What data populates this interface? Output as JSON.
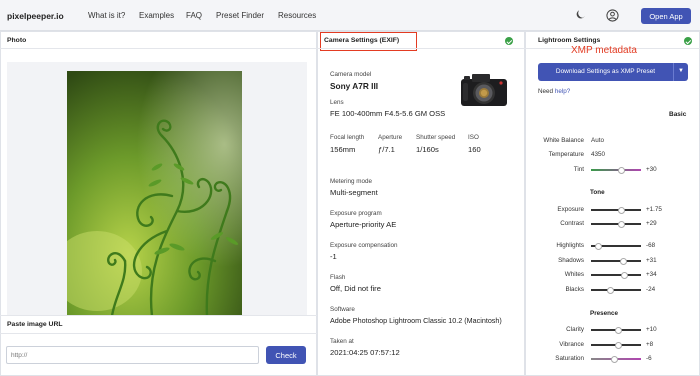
{
  "nav": {
    "logo": "pixelpeeper.io",
    "links": [
      "What is it?",
      "Examples",
      "FAQ",
      "Preset Finder",
      "Resources"
    ],
    "open_app": "Open App",
    "moon_icon": "moon-icon",
    "user_icon": "user-icon"
  },
  "photo_panel": {
    "title": "Photo",
    "paste_label": "Paste image URL",
    "url_placeholder": "http://",
    "check": "Check"
  },
  "exif": {
    "title": "Camera Settings (EXIF)",
    "camera_model_label": "Camera model",
    "camera_model": "Sony A7R III",
    "lens_label": "Lens",
    "lens": "FE 100-400mm F4.5-5.6 GM OSS",
    "focal_length_label": "Focal length",
    "focal_length": "156mm",
    "aperture_label": "Aperture",
    "aperture": "ƒ/7.1",
    "shutter_label": "Shutter speed",
    "shutter": "1/160s",
    "iso_label": "ISO",
    "iso": "160",
    "metering_label": "Metering mode",
    "metering": "Multi-segment",
    "program_label": "Exposure program",
    "program": "Aperture-priority AE",
    "comp_label": "Exposure compensation",
    "comp": "-1",
    "flash_label": "Flash",
    "flash": "Off, Did not fire",
    "software_label": "Software",
    "software": "Adobe Photoshop Lightroom Classic 10.2 (Macintosh)",
    "taken_label": "Taken at",
    "taken": "2021:04:25 07:57:12"
  },
  "lightroom": {
    "title": "Lightroom Settings",
    "annotation": "XMP metadata",
    "download": "Download Settings as XMP Preset",
    "need": "Need ",
    "help": "help?",
    "basic": "Basic",
    "wb_label": "White Balance",
    "wb": "Auto",
    "temp_label": "Temperature",
    "temp": "4350",
    "tint_label": "Tint",
    "tint": "+30",
    "tone": "Tone",
    "exposure_label": "Exposure",
    "exposure": "+1.75",
    "contrast_label": "Contrast",
    "contrast": "+29",
    "highlights_label": "Highlights",
    "highlights": "-68",
    "shadows_label": "Shadows",
    "shadows": "+31",
    "whites_label": "Whites",
    "whites": "+34",
    "blacks_label": "Blacks",
    "blacks": "-24",
    "presence": "Presence",
    "clarity_label": "Clarity",
    "clarity": "+10",
    "vibrance_label": "Vibrance",
    "vibrance": "+8",
    "saturation_label": "Saturation",
    "saturation": "-6"
  },
  "sliders": {
    "tint": 0.6,
    "exposure": 0.6,
    "contrast": 0.6,
    "highlights": 0.15,
    "shadows": 0.65,
    "whites": 0.67,
    "blacks": 0.38,
    "clarity": 0.55,
    "vibrance": 0.54,
    "saturation": 0.47
  },
  "colors": {
    "accent": "#4154b4",
    "annotation": "#e33b22",
    "ok": "#3aa047"
  }
}
